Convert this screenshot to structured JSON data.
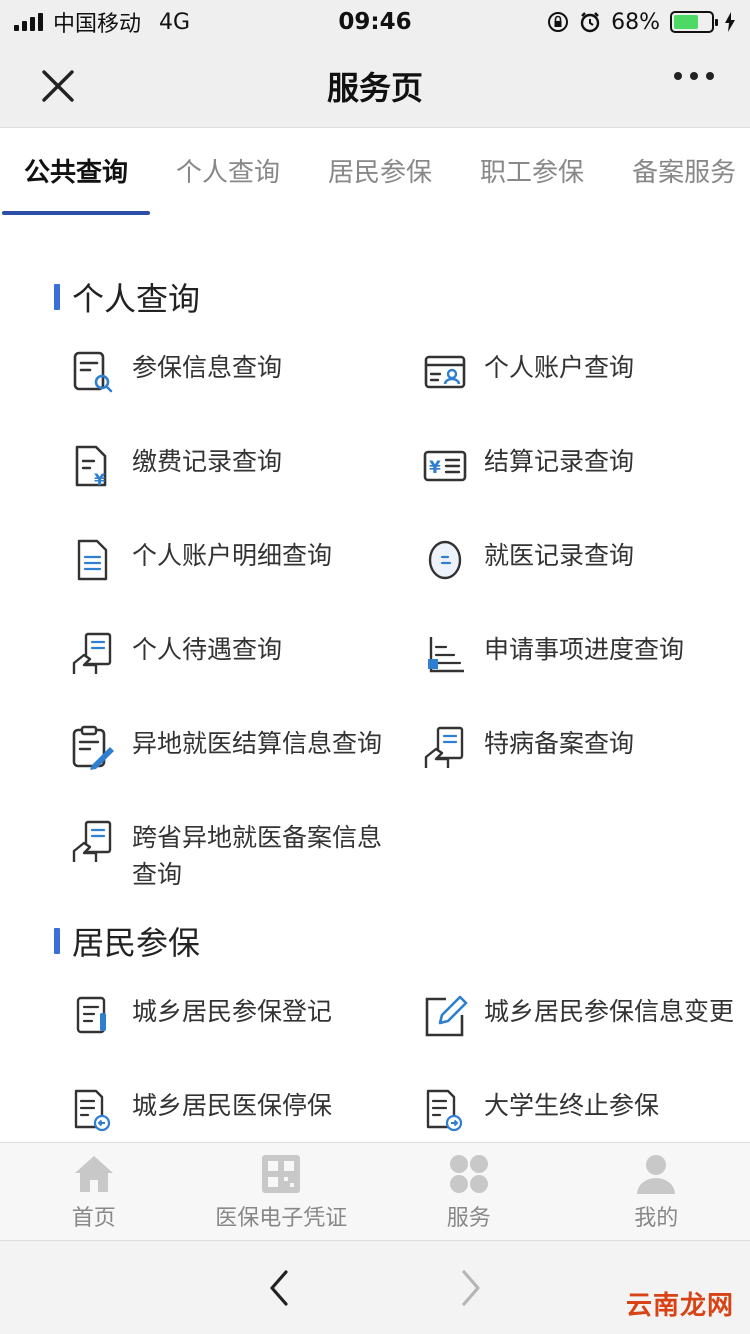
{
  "status_bar": {
    "carrier": "中国移动",
    "network": "4G",
    "time": "09:46",
    "battery": "68%",
    "battery_level": 0.68,
    "battery_color": "#4cd964"
  },
  "nav": {
    "title": "服务页",
    "close_icon": "close-icon",
    "more_icon": "more-icon"
  },
  "tabs": [
    {
      "label": "公共查询",
      "active": true
    },
    {
      "label": "个人查询",
      "active": false
    },
    {
      "label": "居民参保",
      "active": false
    },
    {
      "label": "职工参保",
      "active": false
    },
    {
      "label": "备案服务",
      "active": false
    }
  ],
  "sections": [
    {
      "title": "个人查询",
      "items": [
        {
          "label": "参保信息查询",
          "icon": "document-search-icon"
        },
        {
          "label": "个人账户查询",
          "icon": "account-card-icon"
        },
        {
          "label": "缴费记录查询",
          "icon": "payment-document-icon"
        },
        {
          "label": "结算记录查询",
          "icon": "yuan-card-icon"
        },
        {
          "label": "个人账户明细查询",
          "icon": "document-lines-icon"
        },
        {
          "label": "就医记录查询",
          "icon": "capsule-icon"
        },
        {
          "label": "个人待遇查询",
          "icon": "hand-document-icon"
        },
        {
          "label": "申请事项进度查询",
          "icon": "progress-chart-icon"
        },
        {
          "label": "异地就医结算信息查询",
          "icon": "clipboard-pen-icon"
        },
        {
          "label": "特病备案查询",
          "icon": "hand-document-icon"
        },
        {
          "label": "跨省异地就医备案信息查询",
          "icon": "hand-document-icon"
        }
      ]
    },
    {
      "title": "居民参保",
      "items": [
        {
          "label": "城乡居民参保登记",
          "icon": "register-document-icon"
        },
        {
          "label": "城乡居民参保信息变更",
          "icon": "edit-square-icon"
        },
        {
          "label": "城乡居民医保停保",
          "icon": "document-back-icon"
        },
        {
          "label": "大学生终止参保",
          "icon": "document-forward-icon"
        }
      ]
    }
  ],
  "bottom_tabs": [
    {
      "label": "首页",
      "icon": "home-icon"
    },
    {
      "label": "医保电子凭证",
      "icon": "qr-code-icon"
    },
    {
      "label": "服务",
      "icon": "grid-icon"
    },
    {
      "label": "我的",
      "icon": "user-icon"
    }
  ],
  "browser": {
    "back_icon": "back-arrow-icon",
    "forward_icon": "forward-arrow-icon"
  },
  "watermark": "云南龙网",
  "colors": {
    "accent": "#3a6fd8",
    "tab_underline": "#2b4fa8",
    "icon_blue": "#2f7fd1"
  }
}
